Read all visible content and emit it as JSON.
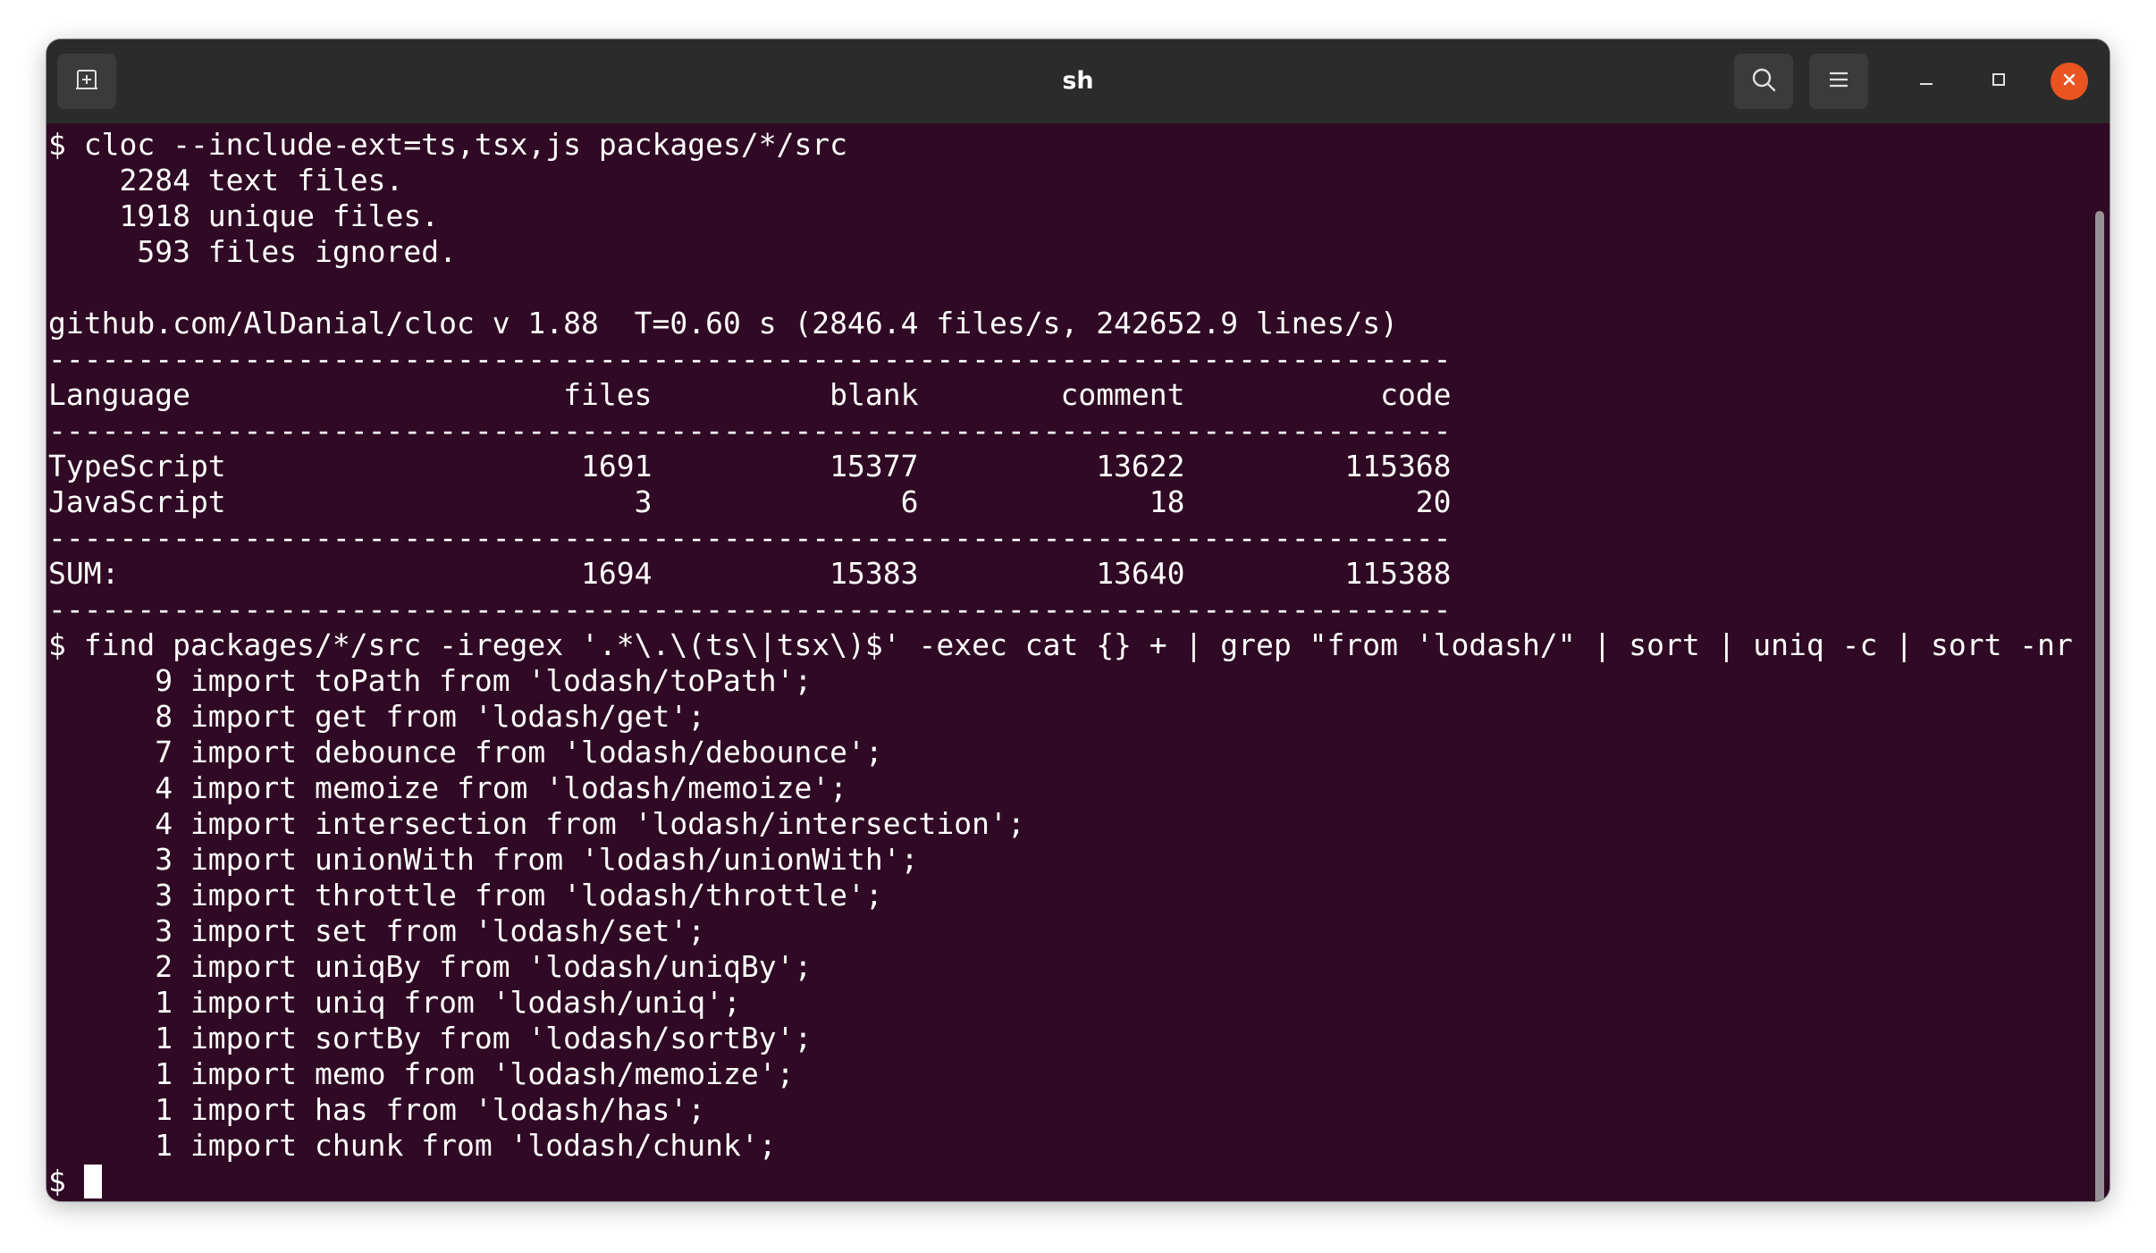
{
  "window": {
    "title": "sh"
  },
  "titlebar": {
    "new_tab_icon": "new-tab-icon",
    "search_icon": "search-icon",
    "menu_icon": "hamburger-menu-icon",
    "minimize_icon": "minimize-icon",
    "maximize_icon": "maximize-icon",
    "close_icon": "close-icon"
  },
  "colors": {
    "terminal_bg": "#300a24",
    "titlebar_bg": "#2b2b2b",
    "close_button": "#e95420",
    "text": "#ffffff"
  },
  "terminal": {
    "lines": [
      "$ cloc --include-ext=ts,tsx,js packages/*/src",
      "    2284 text files.",
      "    1918 unique files.",
      "     593 files ignored.",
      "",
      "github.com/AlDanial/cloc v 1.88  T=0.60 s (2846.4 files/s, 242652.9 lines/s)",
      "-------------------------------------------------------------------------------",
      "Language                     files          blank        comment           code",
      "-------------------------------------------------------------------------------",
      "TypeScript                    1691          15377          13622         115368",
      "JavaScript                       3              6             18             20",
      "-------------------------------------------------------------------------------",
      "SUM:                          1694          15383          13640         115388",
      "-------------------------------------------------------------------------------",
      "$ find packages/*/src -iregex '.*\\.\\(ts\\|tsx\\)$' -exec cat {} + | grep \"from 'lodash/\" | sort | uniq -c | sort -nr",
      "      9 import toPath from 'lodash/toPath';",
      "      8 import get from 'lodash/get';",
      "      7 import debounce from 'lodash/debounce';",
      "      4 import memoize from 'lodash/memoize';",
      "      4 import intersection from 'lodash/intersection';",
      "      3 import unionWith from 'lodash/unionWith';",
      "      3 import throttle from 'lodash/throttle';",
      "      3 import set from 'lodash/set';",
      "      2 import uniqBy from 'lodash/uniqBy';",
      "      1 import uniq from 'lodash/uniq';",
      "      1 import sortBy from 'lodash/sortBy';",
      "      1 import memo from 'lodash/memoize';",
      "      1 import has from 'lodash/has';",
      "      1 import chunk from 'lodash/chunk';"
    ],
    "prompt": "$ "
  }
}
